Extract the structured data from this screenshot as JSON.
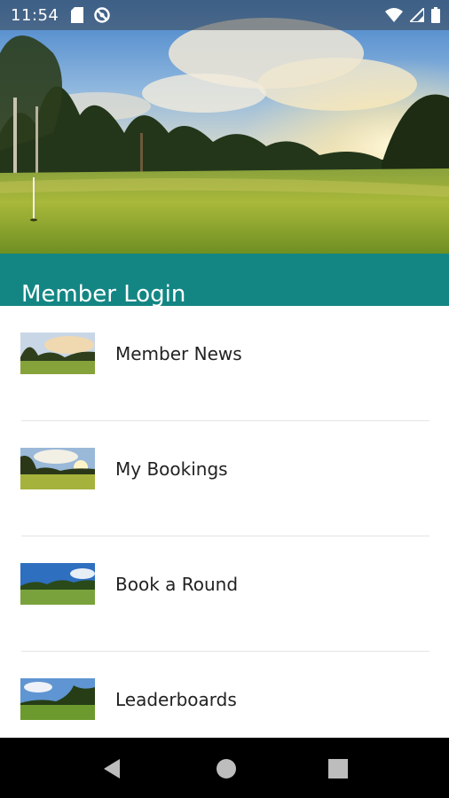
{
  "status_bar": {
    "time": "11:54",
    "icons_left": [
      "sd-card-icon",
      "no-sync-icon"
    ],
    "icons_right": [
      "wifi-icon",
      "cell-signal-icon",
      "battery-icon"
    ]
  },
  "hero": {
    "image": "golf-course-sunrise-photo"
  },
  "header": {
    "title": "Member Login",
    "background_color": "#138684"
  },
  "menu": {
    "items": [
      {
        "label": "Member News",
        "thumbnail": "golf-course-thumbnail-1"
      },
      {
        "label": "My Bookings",
        "thumbnail": "golf-course-thumbnail-2"
      },
      {
        "label": "Book a Round",
        "thumbnail": "golf-course-thumbnail-3"
      },
      {
        "label": "Leaderboards",
        "thumbnail": "golf-course-thumbnail-4"
      }
    ]
  },
  "nav_bar": {
    "buttons": [
      "back-icon",
      "home-icon",
      "recents-icon"
    ]
  }
}
